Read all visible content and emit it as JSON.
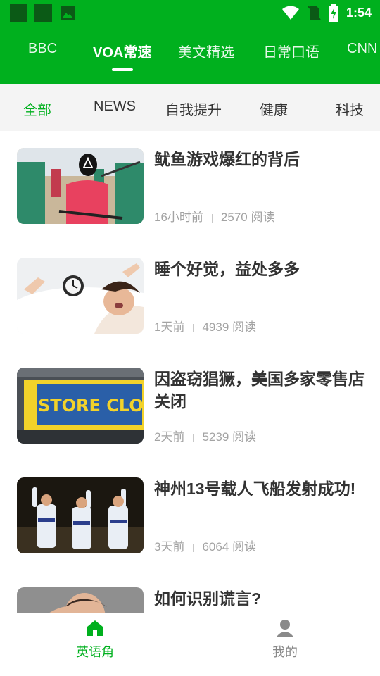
{
  "status_bar": {
    "time": "1:54",
    "left_icons": [
      "app-notification-icon",
      "app-notification-icon",
      "image-icon"
    ],
    "right_icons": [
      "wifi-icon",
      "no-sim-icon",
      "battery-charging-icon"
    ]
  },
  "top_nav": {
    "items": [
      {
        "label": "BBC"
      },
      {
        "label": "VOA常速",
        "active": true
      },
      {
        "label": "美文精选"
      },
      {
        "label": "日常口语"
      },
      {
        "label": "CNN"
      }
    ]
  },
  "category_bar": {
    "items": [
      {
        "label": "全部",
        "active": true
      },
      {
        "label": "NEWS"
      },
      {
        "label": "自我提升"
      },
      {
        "label": "健康"
      },
      {
        "label": "科技"
      }
    ]
  },
  "articles": [
    {
      "title": "鱿鱼游戏爆红的背后",
      "time": "16小时前",
      "reads": "2570 阅读",
      "thumb": "squid-game-guard-image"
    },
    {
      "title": "睡个好觉，益处多多",
      "time": "1天前",
      "reads": "4939 阅读",
      "thumb": "sleeping-woman-alarm-clock-image"
    },
    {
      "title": "因盗窃猖獗，美国多家零售店关闭",
      "time": "2天前",
      "reads": "5239 阅读",
      "thumb": "store-closing-sign-image"
    },
    {
      "title": "神州13号载人飞船发射成功!",
      "time": "3天前",
      "reads": "6064 阅读",
      "thumb": "astronauts-waving-image"
    },
    {
      "title": "如何识别谎言?",
      "time": "",
      "reads": "",
      "thumb": "man-thinking-image"
    }
  ],
  "bottom_nav": {
    "items": [
      {
        "label": "英语角",
        "icon": "home-icon",
        "active": true
      },
      {
        "label": "我的",
        "icon": "profile-icon"
      }
    ]
  },
  "colors": {
    "brand_green": "#00b01e",
    "category_bg": "#f4f4f4",
    "title_text": "#333333",
    "meta_text": "#a3a3a3"
  }
}
